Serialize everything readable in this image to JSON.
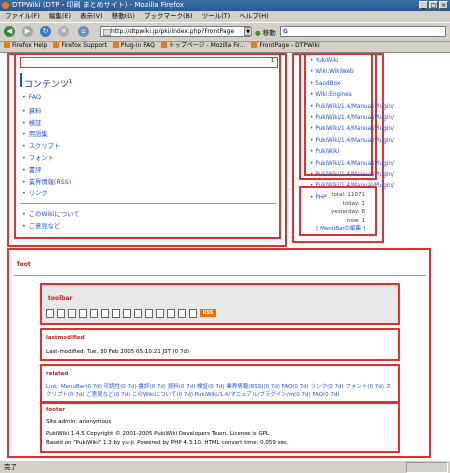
{
  "window": {
    "title": "DTPWiki (DTP・印刷 まとめサイト) - Mozilla Firefox",
    "buttons": [
      "_",
      "□",
      "×"
    ]
  },
  "menubar": [
    "ファイル(F)",
    "編集(E)",
    "表示(V)",
    "移動(G)",
    "ブックマーク(B)",
    "ツール(T)",
    "ヘルプ(H)"
  ],
  "nav": {
    "url": "http://dtpwiki.jp/pki/index.php?FrontPage",
    "go_label": "移動",
    "search_value": "G"
  },
  "bookmarks": [
    "Firefox Help",
    "Firefox Support",
    "Plug-in FAQ",
    "トップページ - Mozilla Fir...",
    "FrontPage - DTPWiki"
  ],
  "main_menu": {
    "marker": "1",
    "title": "コンテンツ",
    "title_sup": "1",
    "items": [
      "FAQ",
      "資料",
      "検証",
      "用語集",
      "スクリプト",
      "フォント",
      "書評",
      "業界情報(RSS)",
      "リンク"
    ],
    "sub_items": [
      "このWikiについて",
      "ご意見など"
    ]
  },
  "sidebar": {
    "links": [
      "YukiWiki",
      "Wiki:WikiWeb",
      "SandBox",
      "Wiki:Engines",
      "PukiWiki/1.4/Manual/Plugin/",
      "PukiWiki/1.4/Manual/Plugin/",
      "PukiWiki/1.4/Manual/Plugin/",
      "PukiWiki/1.4/Manual/Plugin/",
      "PukiWiki",
      "PukiWiki/1.4/Manual/Plugin/",
      "PukiWiki/1.4/Manual/Plugin/",
      "PukiWiki/1.4/Manual/Plugin/",
      "PHP"
    ],
    "counter": [
      "total: 11071",
      "today: 1",
      "yesterday: 8",
      "now: 1"
    ],
    "edit_link": "[ MenuBarの編集 ]"
  },
  "sections": {
    "foot": "foot",
    "toolbar": "toolbar",
    "lastmodified": "lastmodified",
    "lastmodified_text": "Last-modified: Tue, 30 Feb 2005 05:10:21 JST (0 7d)",
    "related": "related",
    "related_text": "Link: MenuBar(0 7d) 可読性(0 7d) 書評(0 7d) 資料(0 7d) 検証(0 7d) 業界情報(RSS)(0 7d) FAQ(0 7d) リンク(0 7d) フォント(0 7d) スクリプト(0 7d) ご意見など(0 7d) このWikiについて(0 7d) PukiWiki/1.4/マニュアル/プラグイン/m(0 7d) FAQ(0 7d)",
    "footer": "footer",
    "footer_admin": "Site admin: anonymous",
    "footer_line1": "PukiWiki 1.4.5 Copyright © 2001-2005 PukiWiki Developers Team. License is GPL.",
    "footer_line2": "Based on \"PukiWiki\" 1.3 by yu-ji. Powered by PHP 4.3.10. HTML convert time: 0.059 sec."
  },
  "toolbar_icons": [
    "top-icon",
    "edit-icon",
    "freeze-icon",
    "diff-icon",
    "backup-icon",
    "upload-icon",
    "copy-icon",
    "rename-icon",
    "reload-icon",
    "new-icon",
    "list-icon",
    "search-icon",
    "recent-icon",
    "help-icon"
  ],
  "rss_label": "RSS",
  "status": "完了",
  "colors": {
    "frame": "#e03030",
    "link": "#2255cc",
    "rss": "#f07010"
  }
}
